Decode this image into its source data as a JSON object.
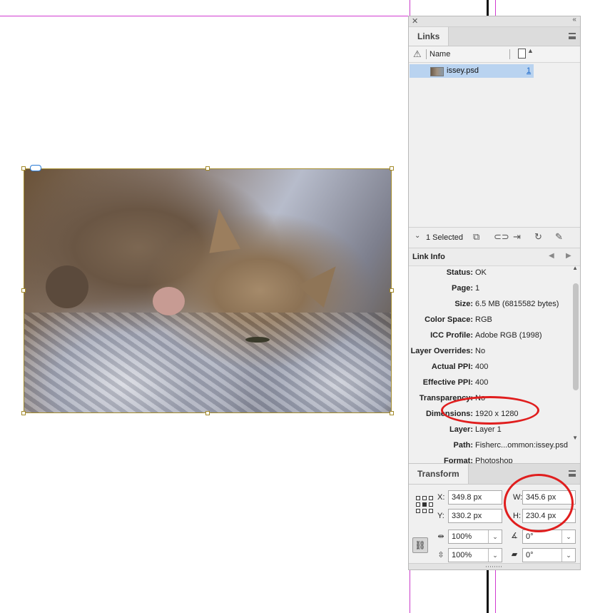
{
  "links_panel": {
    "tab_label": "Links",
    "header": {
      "name_col": "Name"
    },
    "rows": [
      {
        "filename": "issey.psd",
        "page": "1"
      }
    ],
    "toolbar": {
      "selection": "1 Selected"
    }
  },
  "link_info": {
    "title": "Link Info",
    "rows": [
      {
        "key": "Status:",
        "value": "OK"
      },
      {
        "key": "Page:",
        "value": "1"
      },
      {
        "key": "Size:",
        "value": "6.5 MB (6815582 bytes)"
      },
      {
        "key": "Color Space:",
        "value": "RGB"
      },
      {
        "key": "ICC Profile:",
        "value": "Adobe RGB (1998)"
      },
      {
        "key": "Layer Overrides:",
        "value": "No"
      },
      {
        "key": "Actual PPI:",
        "value": "400"
      },
      {
        "key": "Effective PPI:",
        "value": "400"
      },
      {
        "key": "Transparency:",
        "value": "No"
      },
      {
        "key": "Dimensions:",
        "value": "1920 x 1280"
      },
      {
        "key": "Layer:",
        "value": "Layer 1"
      },
      {
        "key": "Path:",
        "value": "Fisherc...ommon:issey.psd"
      },
      {
        "key": "Format:",
        "value": "Photoshop"
      }
    ]
  },
  "transform": {
    "tab_label": "Transform",
    "x_label": "X:",
    "x_value": "349.8 px",
    "y_label": "Y:",
    "y_value": "330.2 px",
    "w_label": "W:",
    "w_value": "345.6 px",
    "h_label": "H:",
    "h_value": "230.4 px",
    "scale_x": "100%",
    "scale_y": "100%",
    "rotation": "0°",
    "shear": "0°"
  },
  "colors": {
    "annotation": "#e01e1e",
    "selection": "#b9d3f0",
    "frame": "#a38a2a",
    "guide": "#d13bd1"
  }
}
